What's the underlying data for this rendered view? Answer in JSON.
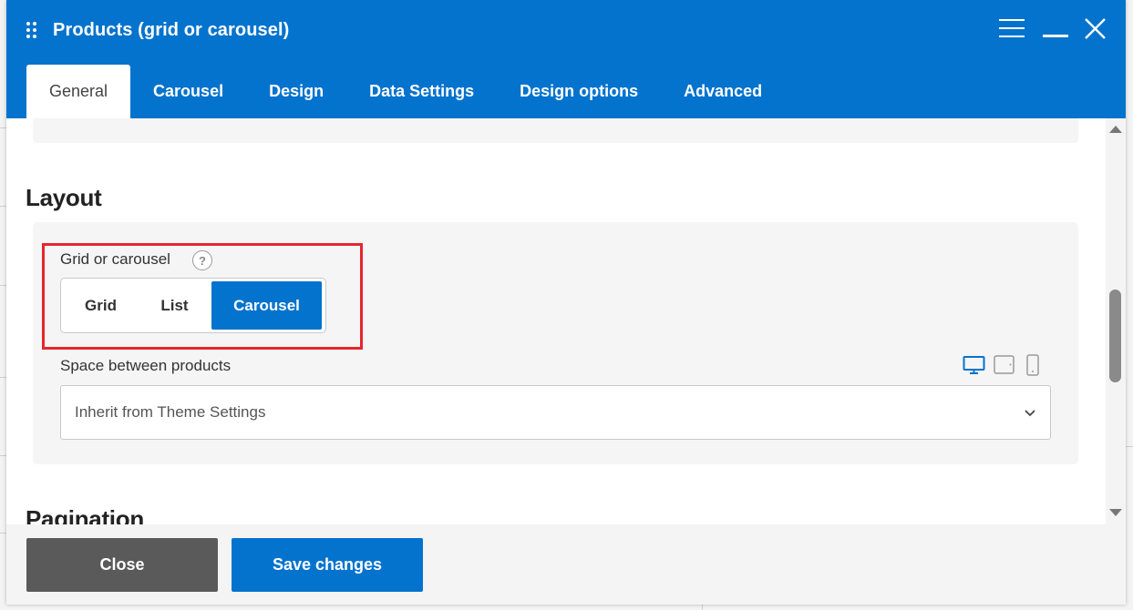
{
  "modal": {
    "title": "Products (grid or carousel)"
  },
  "tabs": [
    {
      "label": "General",
      "active": true
    },
    {
      "label": "Carousel",
      "active": false
    },
    {
      "label": "Design",
      "active": false
    },
    {
      "label": "Data Settings",
      "active": false
    },
    {
      "label": "Design options",
      "active": false
    },
    {
      "label": "Advanced",
      "active": false
    }
  ],
  "layout": {
    "section_title": "Layout",
    "grid_or_carousel": {
      "label": "Grid or carousel",
      "help": "?",
      "options": [
        "Grid",
        "List",
        "Carousel"
      ],
      "selected": "Carousel"
    },
    "space_between": {
      "label": "Space between products",
      "value": "Inherit from Theme Settings",
      "devices": [
        "desktop-icon",
        "tablet-icon",
        "mobile-icon"
      ],
      "active_device": "desktop-icon"
    }
  },
  "pagination": {
    "section_title": "Pagination"
  },
  "footer": {
    "close_label": "Close",
    "save_label": "Save changes"
  },
  "colors": {
    "primary": "#0473cd",
    "highlight": "#e5262e",
    "close_button": "#5a5a5a"
  }
}
